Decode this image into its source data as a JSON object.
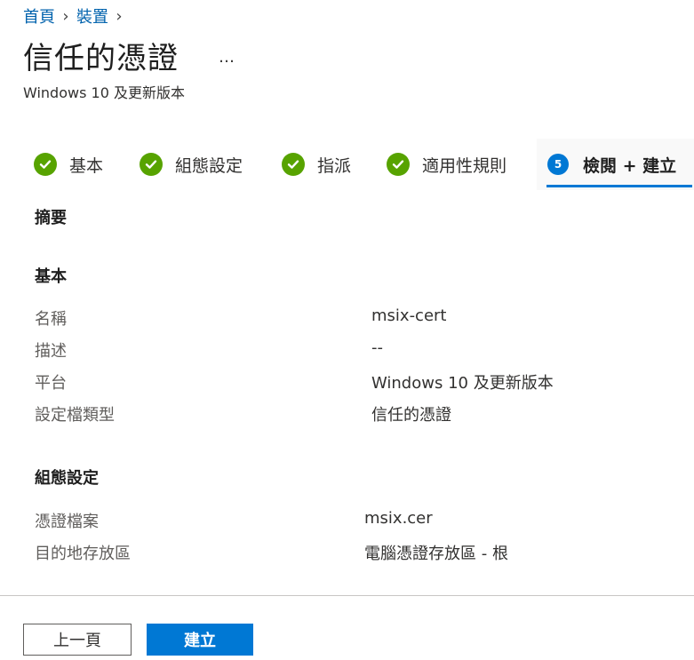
{
  "breadcrumb": {
    "items": [
      {
        "label": "首頁"
      },
      {
        "label": "裝置"
      }
    ],
    "separator": "›"
  },
  "page": {
    "title": "信任的憑證",
    "more_label": "…",
    "subtitle": "Windows 10 及更新版本"
  },
  "tabs": [
    {
      "label": "基本",
      "status": "complete"
    },
    {
      "label": "組態設定",
      "status": "complete"
    },
    {
      "label": "指派",
      "status": "complete"
    },
    {
      "label": "適用性規則",
      "status": "complete"
    },
    {
      "label": "檢閱 + 建立",
      "status": "active",
      "step": "5"
    }
  ],
  "summary": {
    "heading": "摘要",
    "sections": [
      {
        "heading": "基本",
        "rows": [
          {
            "label": "名稱",
            "value": "msix-cert"
          },
          {
            "label": "描述",
            "value": "--"
          },
          {
            "label": "平台",
            "value": "Windows 10 及更新版本"
          },
          {
            "label": "設定檔類型",
            "value": "信任的憑證"
          }
        ]
      },
      {
        "heading": "組態設定",
        "rows": [
          {
            "label": "憑證檔案",
            "value": "msix.cer"
          },
          {
            "label": "目的地存放區",
            "value": "電腦憑證存放區 - 根"
          }
        ]
      }
    ]
  },
  "footer": {
    "previous_label": "上一頁",
    "create_label": "建立"
  },
  "colors": {
    "accent": "#0078d4",
    "link": "#0062ad",
    "success": "#57a300"
  },
  "icons": {
    "complete": "checkmark-circle-icon",
    "more": "ellipsis-icon"
  }
}
